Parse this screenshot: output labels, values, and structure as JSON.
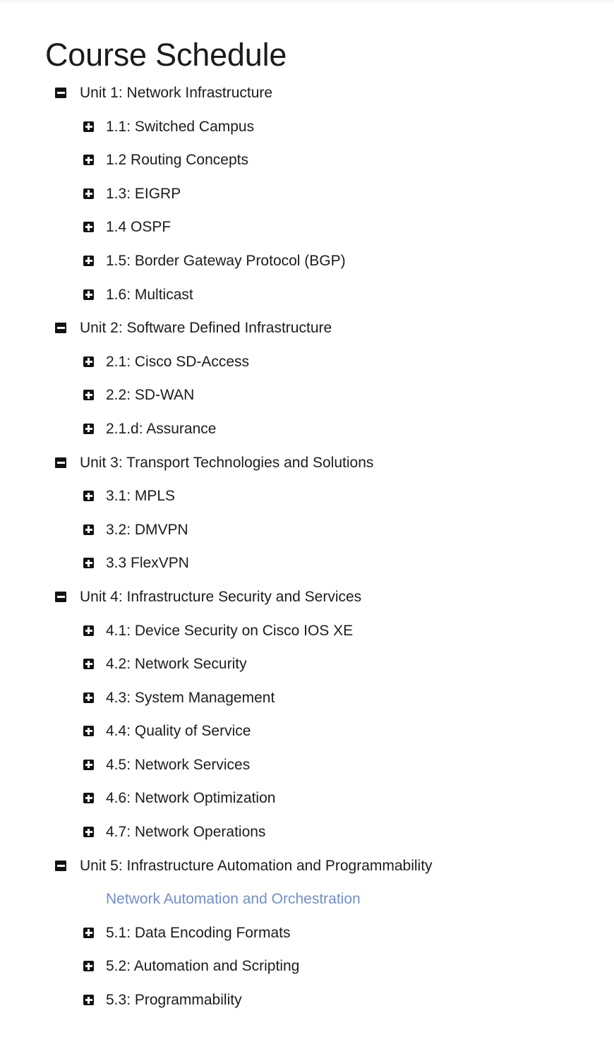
{
  "page": {
    "title": "Course Schedule"
  },
  "icons": {
    "expanded": "minus-square-icon",
    "collapsed": "plus-square-icon"
  },
  "colors": {
    "text": "#1c1c1e",
    "title": "#1b1b1d",
    "link": "#7190c4",
    "icon_background": "#131316",
    "icon_glyph": "#ffffff",
    "page_background": "#ffffff"
  },
  "tree": [
    {
      "type": "unit",
      "state": "expanded",
      "label": "Unit 1: Network Infrastructure",
      "children": [
        {
          "type": "lesson",
          "state": "collapsed",
          "label": "1.1: Switched Campus"
        },
        {
          "type": "lesson",
          "state": "collapsed",
          "label": "1.2 Routing Concepts"
        },
        {
          "type": "lesson",
          "state": "collapsed",
          "label": "1.3: EIGRP"
        },
        {
          "type": "lesson",
          "state": "collapsed",
          "label": "1.4 OSPF"
        },
        {
          "type": "lesson",
          "state": "collapsed",
          "label": "1.5: Border Gateway Protocol (BGP)"
        },
        {
          "type": "lesson",
          "state": "collapsed",
          "label": "1.6: Multicast"
        }
      ]
    },
    {
      "type": "unit",
      "state": "expanded",
      "label": "Unit 2: Software Defined Infrastructure",
      "children": [
        {
          "type": "lesson",
          "state": "collapsed",
          "label": "2.1: Cisco SD-Access"
        },
        {
          "type": "lesson",
          "state": "collapsed",
          "label": "2.2: SD-WAN"
        },
        {
          "type": "lesson",
          "state": "collapsed",
          "label": "2.1.d: Assurance"
        }
      ]
    },
    {
      "type": "unit",
      "state": "expanded",
      "label": "Unit 3: Transport Technologies and Solutions",
      "children": [
        {
          "type": "lesson",
          "state": "collapsed",
          "label": "3.1: MPLS"
        },
        {
          "type": "lesson",
          "state": "collapsed",
          "label": "3.2: DMVPN"
        },
        {
          "type": "lesson",
          "state": "collapsed",
          "label": "3.3 FlexVPN"
        }
      ]
    },
    {
      "type": "unit",
      "state": "expanded",
      "label": "Unit 4: Infrastructure Security and Services",
      "children": [
        {
          "type": "lesson",
          "state": "collapsed",
          "label": "4.1: Device Security on Cisco IOS XE"
        },
        {
          "type": "lesson",
          "state": "collapsed",
          "label": "4.2: Network Security"
        },
        {
          "type": "lesson",
          "state": "collapsed",
          "label": "4.3: System Management"
        },
        {
          "type": "lesson",
          "state": "collapsed",
          "label": "4.4: Quality of Service"
        },
        {
          "type": "lesson",
          "state": "collapsed",
          "label": "4.5: Network Services"
        },
        {
          "type": "lesson",
          "state": "collapsed",
          "label": "4.6: Network Optimization"
        },
        {
          "type": "lesson",
          "state": "collapsed",
          "label": "4.7: Network Operations"
        }
      ]
    },
    {
      "type": "unit",
      "state": "expanded",
      "label": "Unit 5: Infrastructure Automation and Programmability",
      "children": [
        {
          "type": "link",
          "label": "Network Automation and Orchestration"
        },
        {
          "type": "lesson",
          "state": "collapsed",
          "label": "5.1: Data Encoding Formats"
        },
        {
          "type": "lesson",
          "state": "collapsed",
          "label": "5.2: Automation and Scripting"
        },
        {
          "type": "lesson",
          "state": "collapsed",
          "label": "5.3: Programmability"
        }
      ]
    }
  ]
}
